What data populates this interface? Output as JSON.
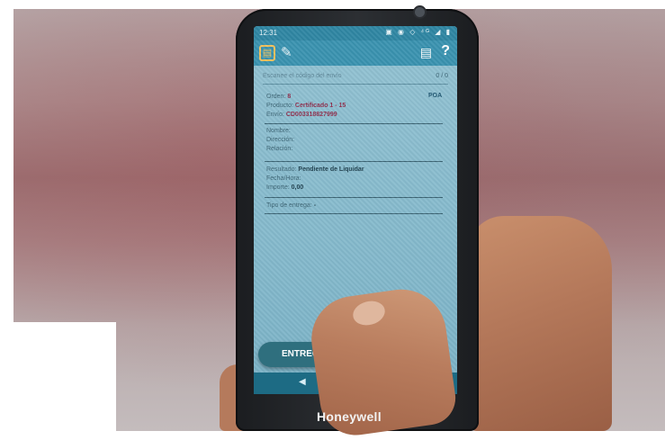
{
  "status_bar": {
    "time": "12:31",
    "icons": "▣ ◉ ◇ ⁴ᴳ ◢ ▮"
  },
  "app_bar": {
    "logo_glyph": "▤",
    "wand_glyph": "✎",
    "doc_glyph": "▤",
    "help_label": "?"
  },
  "search": {
    "placeholder": "Escanee el código del envío",
    "counter": "0 / 0"
  },
  "order": {
    "poa_label": "POA",
    "orden_label": "Orden:",
    "orden_value": "8",
    "producto_label": "Producto:",
    "producto_value": "Certificado 1 - 15",
    "envio_label": "Envío:",
    "envio_value": "CD003318827999"
  },
  "recipient": {
    "nombre_label": "Nombre:",
    "direccion_label": "Dirección:",
    "relacion_label": "Relación:"
  },
  "result": {
    "resultado_label": "Resultado:",
    "resultado_value": "Pendiente de Liquidar",
    "fecha_label": "Fecha/Hora:",
    "importe_label": "Importe:",
    "importe_value": "0,00"
  },
  "delivery": {
    "tipo_label": "Tipo de entrega:",
    "tipo_value": "-"
  },
  "button": {
    "entregar_label": "ENTREGA"
  },
  "nav": {
    "back_glyph": "◀",
    "home_glyph": "●"
  },
  "brand": "Honeywell"
}
